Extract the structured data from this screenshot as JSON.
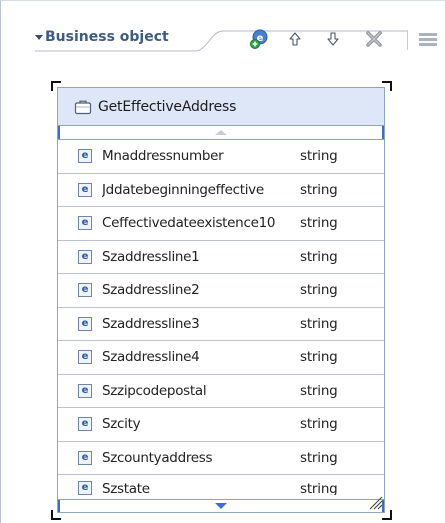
{
  "section": {
    "title": "Business object"
  },
  "toolbar": {
    "add_icon": "add-attribute-icon",
    "up_icon": "arrow-up-icon",
    "down_icon": "arrow-down-icon",
    "delete_icon": "delete-x-icon",
    "menu_icon": "menu-lines-icon"
  },
  "business_object": {
    "name": "GetEffectiveAddress",
    "icon": "briefcase-icon",
    "attribute_icon_letter": "e",
    "attributes": [
      {
        "name": "Mnaddressnumber",
        "type": "string"
      },
      {
        "name": "Jddatebeginningeffective",
        "type": "string"
      },
      {
        "name": "Ceffectivedateexistence10",
        "type": "string"
      },
      {
        "name": "Szaddressline1",
        "type": "string"
      },
      {
        "name": "Szaddressline2",
        "type": "string"
      },
      {
        "name": "Szaddressline3",
        "type": "string"
      },
      {
        "name": "Szaddressline4",
        "type": "string"
      },
      {
        "name": "Szzipcodepostal",
        "type": "string"
      },
      {
        "name": "Szcity",
        "type": "string"
      },
      {
        "name": "Szcountyaddress",
        "type": "string"
      },
      {
        "name": "Szstate",
        "type": "string"
      }
    ]
  },
  "colors": {
    "section_title": "#3f5b84",
    "header_bg": "#dee7f8",
    "box_border": "#8fa3c4",
    "scroll_arrow": "#3a6ee0"
  }
}
